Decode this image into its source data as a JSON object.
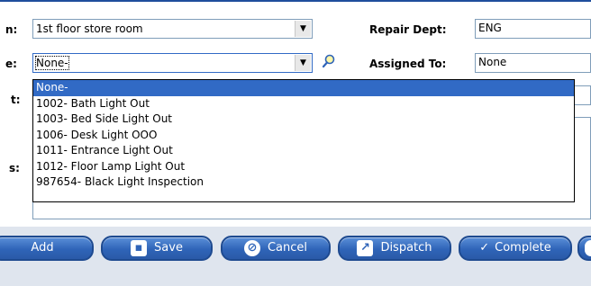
{
  "form": {
    "location_label": "n:",
    "location_value": "1st floor store room",
    "repair_dept_label": "Repair Dept:",
    "repair_dept_value": "ENG",
    "type_label": "e:",
    "type_value": "None-",
    "assigned_to_label": "Assigned To:",
    "assigned_to_value": "None",
    "third_label": "t:",
    "fourth_label": "s:"
  },
  "dropdown": {
    "options": [
      "None-",
      "1002- Bath Light Out",
      "1003- Bed Side Light Out",
      "1006- Desk Light OOO",
      "1011- Entrance Light Out",
      "1012- Floor Lamp Light Out",
      "987654- Black Light Inspection"
    ],
    "selected_index": 0
  },
  "buttons": {
    "add": "Add",
    "save": "Save",
    "cancel": "Cancel",
    "dispatch": "Dispatch",
    "complete": "Complete"
  },
  "colors": {
    "accent": "#316ac5",
    "button": "#2f64b8"
  }
}
